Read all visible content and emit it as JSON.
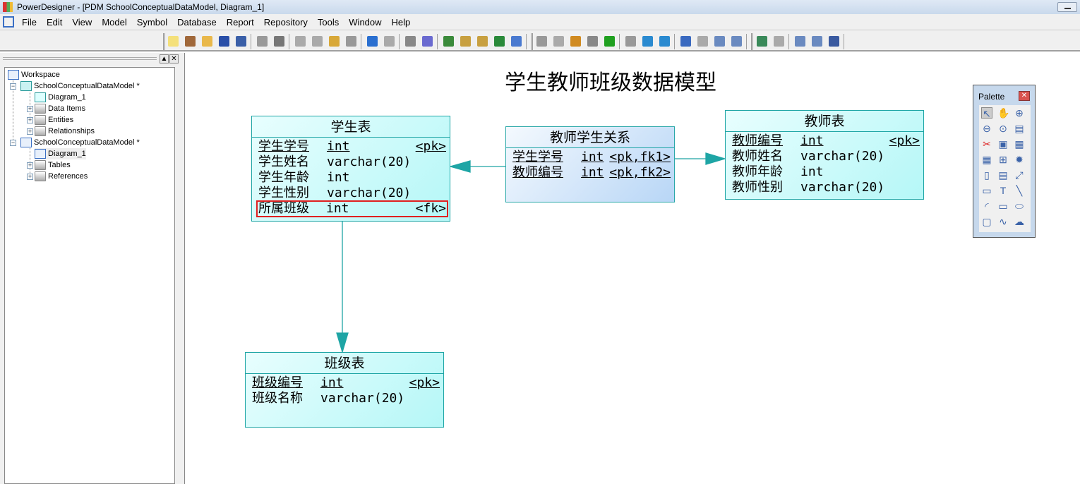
{
  "window": {
    "title": "PowerDesigner - [PDM SchoolConceptualDataModel, Diagram_1]"
  },
  "menu": [
    "File",
    "Edit",
    "View",
    "Model",
    "Symbol",
    "Database",
    "Report",
    "Repository",
    "Tools",
    "Window",
    "Help"
  ],
  "toolbar_icons": [
    "new-model",
    "new-project",
    "open",
    "save",
    "save-all",
    "print-preview",
    "print",
    "cut",
    "copy",
    "paste",
    "delete",
    "undo",
    "redo",
    "properties",
    "help",
    "new-package",
    "paste-as-shortcut",
    "find",
    "refresh",
    "check-model",
    "group",
    "ungroup",
    "line-style",
    "fill-format",
    "font",
    "bring-front",
    "move-left",
    "move-right",
    "diagram-view",
    "format",
    "page",
    "two-pages",
    "impact-analysis",
    "compare",
    "zoom-to-fit",
    "list-view",
    "grid-view"
  ],
  "tree": {
    "workspace": "Workspace",
    "cdm": {
      "label": "SchoolConceptualDataModel *",
      "diagram": "Diagram_1",
      "children": [
        "Data Items",
        "Entities",
        "Relationships"
      ]
    },
    "pdm": {
      "label": "SchoolConceptualDataModel *",
      "diagram": "Diagram_1",
      "children": [
        "Tables",
        "References"
      ]
    }
  },
  "diagram": {
    "title": "学生教师班级数据模型",
    "student": {
      "name": "学生表",
      "columns": [
        {
          "name": "学生学号",
          "type": "int",
          "key": "<pk>",
          "underline": true
        },
        {
          "name": "学生姓名",
          "type": "varchar(20)",
          "key": ""
        },
        {
          "name": "学生年龄",
          "type": "int",
          "key": ""
        },
        {
          "name": "学生性别",
          "type": "varchar(20)",
          "key": ""
        },
        {
          "name": "所属班级",
          "type": "int",
          "key": "<fk>",
          "selected": true
        }
      ]
    },
    "relation": {
      "name": "教师学生关系",
      "columns": [
        {
          "name": "学生学号",
          "type": "int",
          "key": "<pk,fk1>",
          "underline": true
        },
        {
          "name": "教师编号",
          "type": "int",
          "key": "<pk,fk2>",
          "underline": true
        }
      ]
    },
    "teacher": {
      "name": "教师表",
      "columns": [
        {
          "name": "教师编号",
          "type": "int",
          "key": "<pk>",
          "underline": true
        },
        {
          "name": "教师姓名",
          "type": "varchar(20)",
          "key": ""
        },
        {
          "name": "教师年龄",
          "type": "int",
          "key": ""
        },
        {
          "name": "教师性别",
          "type": "varchar(20)",
          "key": ""
        }
      ]
    },
    "class": {
      "name": "班级表",
      "columns": [
        {
          "name": "班级编号",
          "type": "int",
          "key": "<pk>",
          "underline": true
        },
        {
          "name": "班级名称",
          "type": "varchar(20)",
          "key": ""
        }
      ]
    }
  },
  "palette": {
    "title": "Palette",
    "tools": [
      "pointer",
      "grabber",
      "zoom-in",
      "zoom-out",
      "open-package",
      "properties",
      "delete",
      "package",
      "table",
      "view",
      "reference",
      "procedure",
      "file",
      "text-note",
      "link",
      "text",
      "title",
      "line",
      "arc",
      "rectangle",
      "ellipse",
      "rounded-rectangle",
      "polyline",
      "polygon"
    ]
  },
  "colors": {
    "entity_border": "#1ea5a5",
    "entity_fill": "#b5f7f7",
    "relation_fill": "#b8d6f6",
    "selection": "#e02020"
  }
}
